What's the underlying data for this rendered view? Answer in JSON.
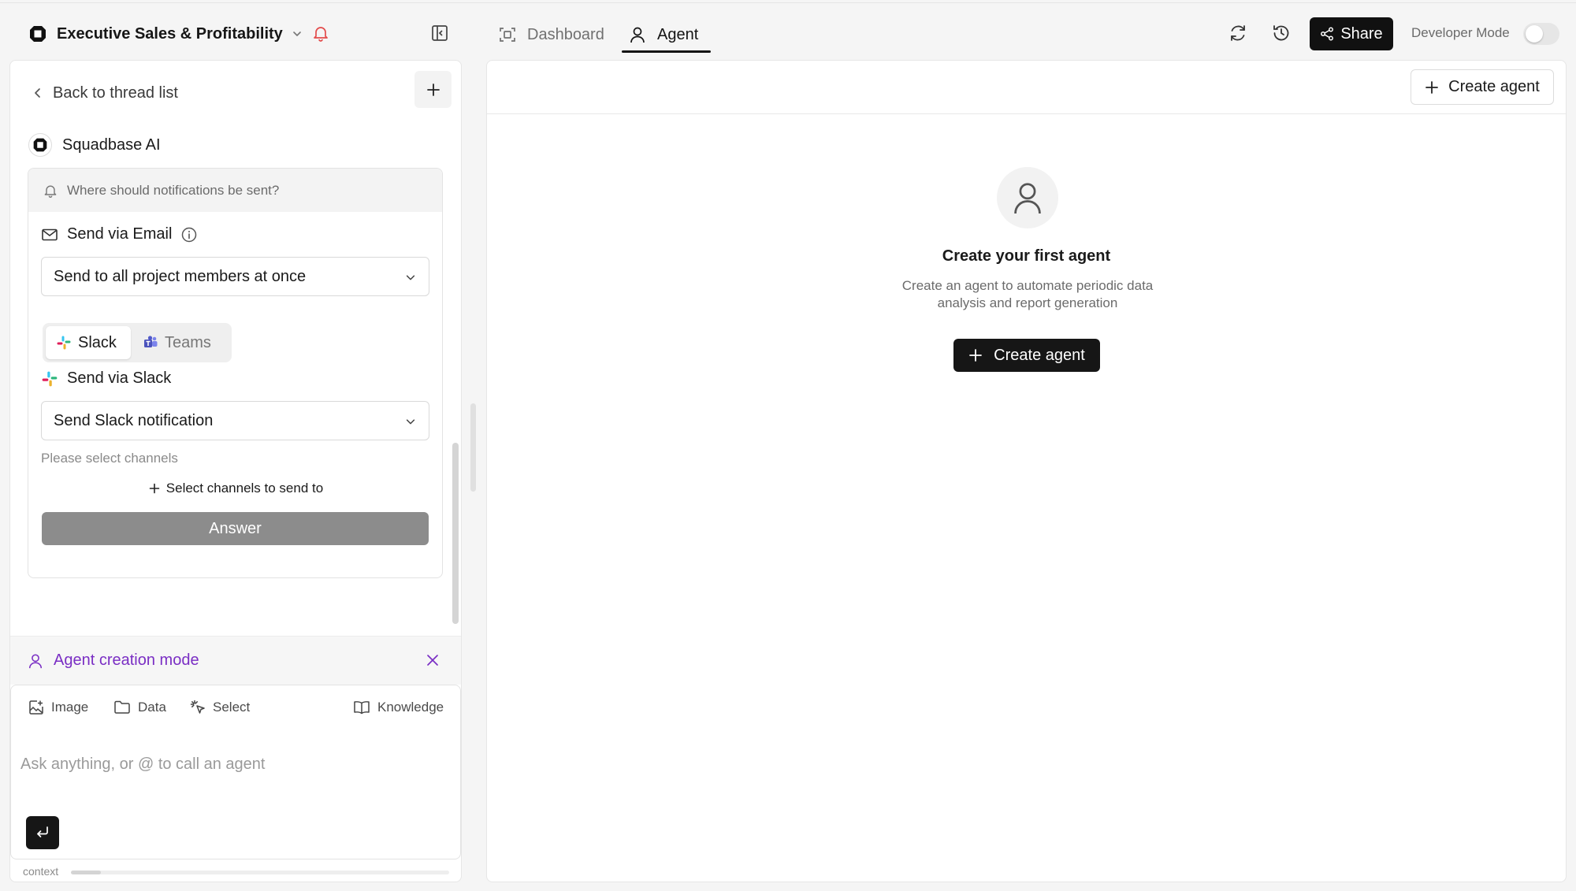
{
  "header": {
    "project_title": "Executive Sales & Profitability",
    "tabs": [
      {
        "label": "Dashboard",
        "active": false
      },
      {
        "label": "Agent",
        "active": true
      }
    ],
    "share_label": "Share",
    "developer_mode_label": "Developer Mode",
    "developer_mode_on": false
  },
  "sidebar": {
    "back_label": "Back to thread list",
    "sender_name": "Squadbase AI",
    "card": {
      "question": "Where should notifications be sent?",
      "email_label": "Send via Email",
      "email_option": "Send to all project members at once",
      "channel_tabs": [
        {
          "label": "Slack",
          "active": true
        },
        {
          "label": "Teams",
          "active": false
        }
      ],
      "slack_label": "Send via Slack",
      "slack_option": "Send Slack notification",
      "channels_hint": "Please select channels",
      "select_channels_label": "Select channels to send to",
      "answer_label": "Answer"
    },
    "mode_label": "Agent creation mode",
    "composer": {
      "tools": {
        "image": "Image",
        "data": "Data",
        "select": "Select",
        "knowledge": "Knowledge"
      },
      "placeholder": "Ask anything, or @ to call an agent"
    },
    "context_label": "context",
    "context_usage": 0.08
  },
  "main": {
    "create_agent_label": "Create agent",
    "empty_title": "Create your first agent",
    "empty_description": "Create an agent to automate periodic data analysis and report generation",
    "empty_button_label": "Create agent"
  },
  "colors": {
    "accent_purple": "#7a2ec4",
    "dark_button": "#161616",
    "answer_button": "#8c8c8c"
  }
}
